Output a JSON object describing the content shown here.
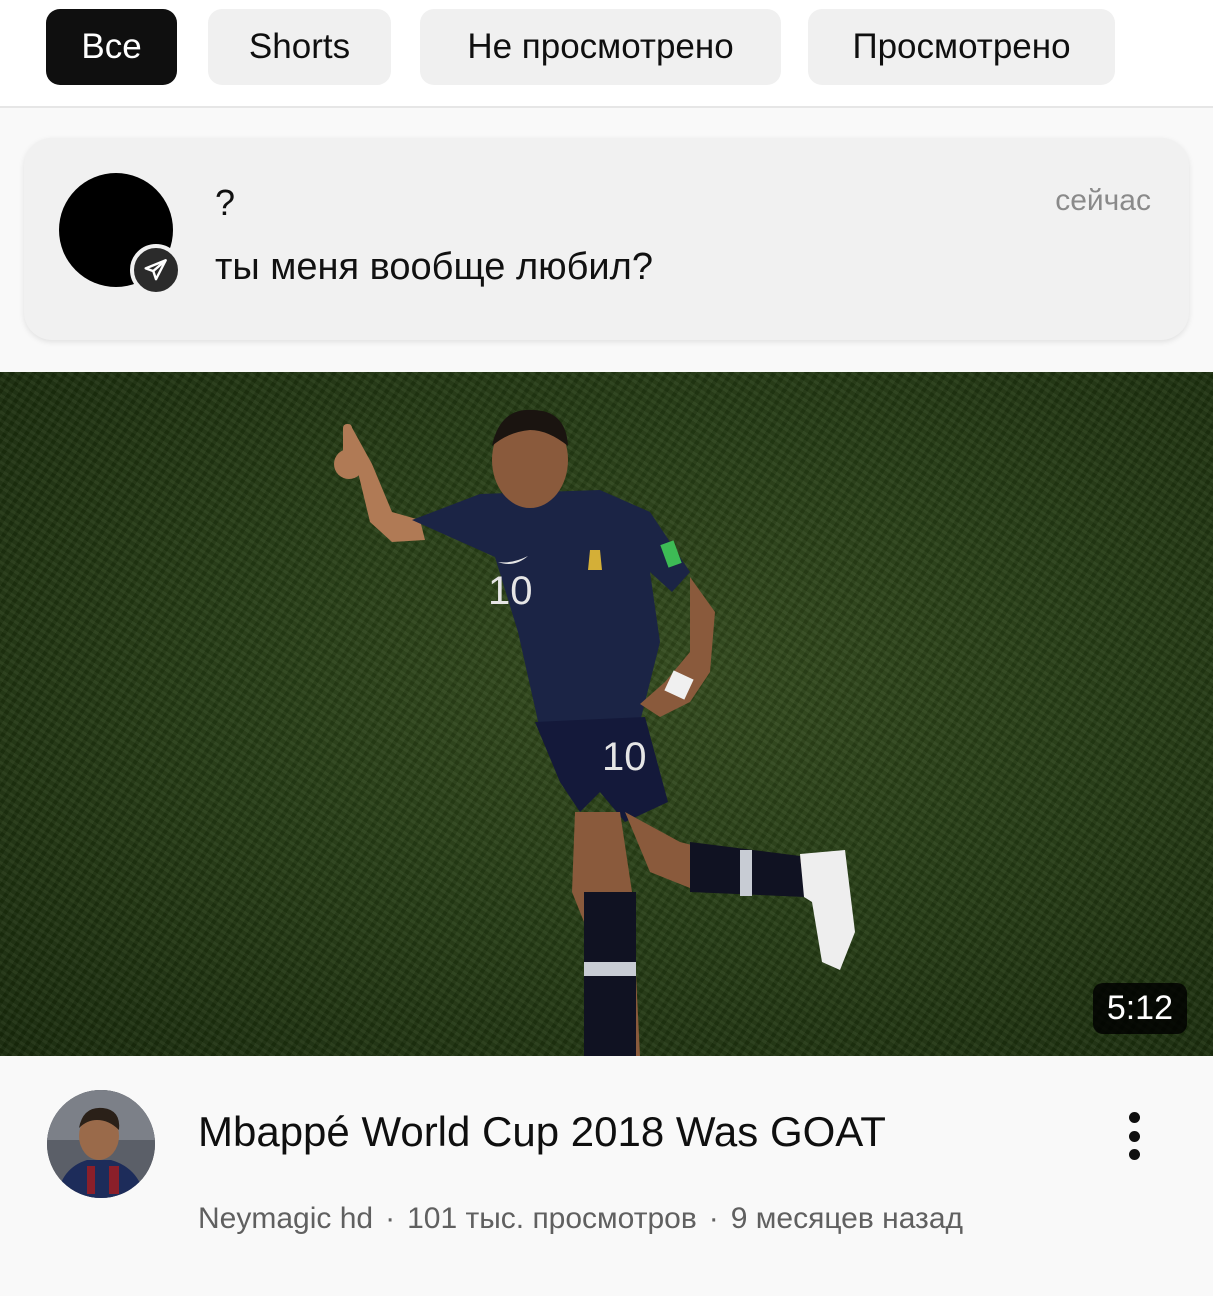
{
  "chips": [
    {
      "label": "Все",
      "active": true
    },
    {
      "label": "Shorts",
      "active": false
    },
    {
      "label": "Не просмотрено",
      "active": false
    },
    {
      "label": "Просмотрено",
      "active": false
    }
  ],
  "notification": {
    "sender": "?",
    "message": "ты меня вообще любил?",
    "time": "сейчас",
    "badge_icon": "telegram-send-icon"
  },
  "video": {
    "duration": "5:12",
    "title": "Mbappé World Cup 2018 Was GOAT",
    "channel": "Neymagic hd",
    "views": "101 тыс. просмотров",
    "age": "9 месяцев назад",
    "separator": "·",
    "jersey_number": "10",
    "menu_icon": "more-vertical-icon"
  },
  "colors": {
    "active_chip": "#0f0f0f",
    "chip": "#f0f0f0",
    "jersey": "#1a2240",
    "grass": "#2a4216"
  }
}
